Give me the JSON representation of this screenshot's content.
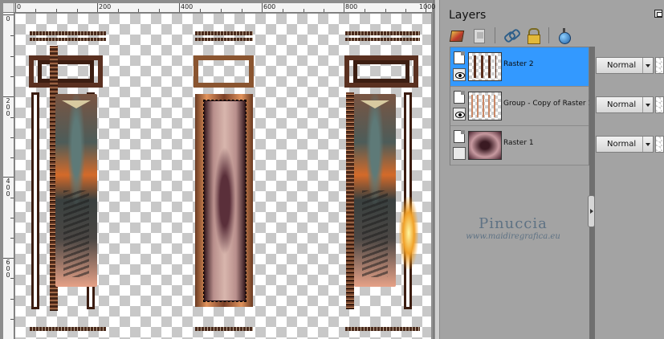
{
  "rulers": {
    "top_labels": [
      "0",
      "200",
      "400",
      "600",
      "800",
      "1000"
    ],
    "left_labels": [
      "0",
      "2 0 0",
      "4 0 0",
      "6 0 0"
    ]
  },
  "layers_panel": {
    "title": "Layers",
    "toolbar_icons": [
      "brush-icon",
      "mask-icon",
      "link-icon",
      "lock-icon",
      "bulb-icon"
    ],
    "layers": [
      {
        "name": "Raster 2",
        "blend_mode": "Normal",
        "selected": true,
        "visible": true
      },
      {
        "name": "Group - Copy of Raster 1",
        "blend_mode": "Normal",
        "selected": false,
        "visible": true
      },
      {
        "name": "Raster 1",
        "blend_mode": "Normal",
        "selected": false,
        "visible": false
      }
    ],
    "accent_color": "#3399ff"
  },
  "watermark": {
    "name": "Pinuccia",
    "url": "www.maidiregrafica.eu"
  }
}
